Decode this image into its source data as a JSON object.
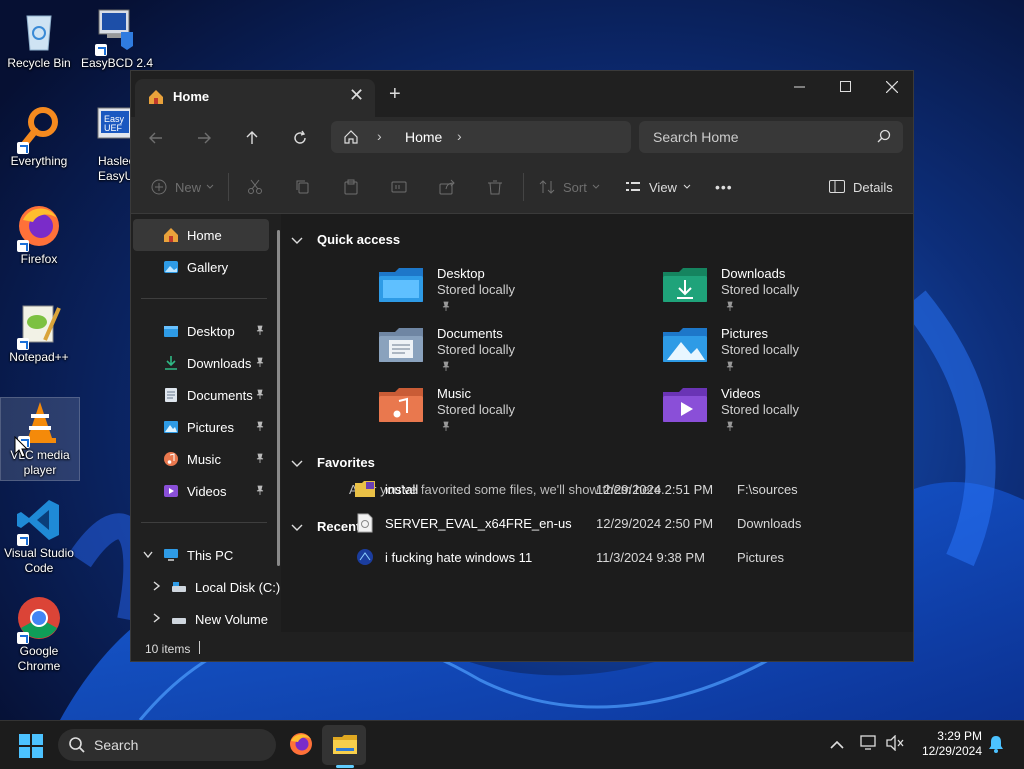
{
  "desktop": {
    "icons": [
      {
        "label": "Recycle Bin"
      },
      {
        "label": "EasyBCD 2.4"
      },
      {
        "label": "Everything"
      },
      {
        "label": "Hasleo EasyUEFI"
      },
      {
        "label": "Firefox"
      },
      {
        "label": "Notepad++"
      },
      {
        "label": "VLC media player"
      },
      {
        "label": "Visual Studio Code"
      },
      {
        "label": "Google Chrome"
      }
    ]
  },
  "window": {
    "tab": {
      "title": "Home",
      "icon": "home-icon",
      "close_glyph": "✕"
    },
    "new_tab_glyph": "+",
    "controls": {
      "minimize": "minimize-icon",
      "maximize": "maximize-icon",
      "close": "close-icon"
    },
    "nav": {
      "breadcrumb": {
        "label": "Home",
        "separator": "›"
      },
      "search": {
        "placeholder": "Search Home"
      }
    },
    "toolbar": {
      "new_label": "New",
      "sort_label": "Sort",
      "view_label": "View",
      "more_glyph": "•••",
      "details_label": "Details"
    },
    "sidebar": {
      "top_items": [
        {
          "label": "Home",
          "icon": "home-icon",
          "active": true
        },
        {
          "label": "Gallery",
          "icon": "gallery-icon"
        }
      ],
      "pinned_items": [
        {
          "label": "Desktop",
          "icon": "desktop-folder-icon"
        },
        {
          "label": "Downloads",
          "icon": "downloads-icon"
        },
        {
          "label": "Documents",
          "icon": "documents-icon"
        },
        {
          "label": "Pictures",
          "icon": "pictures-icon"
        },
        {
          "label": "Music",
          "icon": "music-icon"
        },
        {
          "label": "Videos",
          "icon": "videos-icon"
        }
      ],
      "this_pc": {
        "label": "This PC"
      },
      "drives": [
        {
          "label": "Local Disk (C:)"
        },
        {
          "label": "New Volume (I"
        }
      ]
    },
    "content": {
      "quick_access": {
        "title": "Quick access",
        "items": [
          {
            "name": "Desktop",
            "sub": "Stored locally",
            "color": "#2e9be6"
          },
          {
            "name": "Downloads",
            "sub": "Stored locally",
            "color": "#1fa37a"
          },
          {
            "name": "Documents",
            "sub": "Stored locally",
            "color": "#8aa2bd"
          },
          {
            "name": "Pictures",
            "sub": "Stored locally",
            "color": "#2e9be6"
          },
          {
            "name": "Music",
            "sub": "Stored locally",
            "color": "#e9784e"
          },
          {
            "name": "Videos",
            "sub": "Stored locally",
            "color": "#8a4fd8"
          }
        ]
      },
      "favorites": {
        "title": "Favorites",
        "empty_text": "After you've favorited some files, we'll show them here."
      },
      "recent": {
        "title": "Recent",
        "rows": [
          {
            "name": "install",
            "date": "12/29/2024 2:51 PM",
            "location": "F:\\sources"
          },
          {
            "name": "SERVER_EVAL_x64FRE_en-us",
            "date": "12/29/2024 2:50 PM",
            "location": "Downloads"
          },
          {
            "name": "i fucking hate windows 11",
            "date": "11/3/2024 9:38 PM",
            "location": "Pictures"
          }
        ]
      }
    },
    "status": {
      "items_count": "10 items"
    }
  },
  "taskbar": {
    "search_placeholder": "Search",
    "time": "3:29 PM",
    "date": "12/29/2024"
  }
}
